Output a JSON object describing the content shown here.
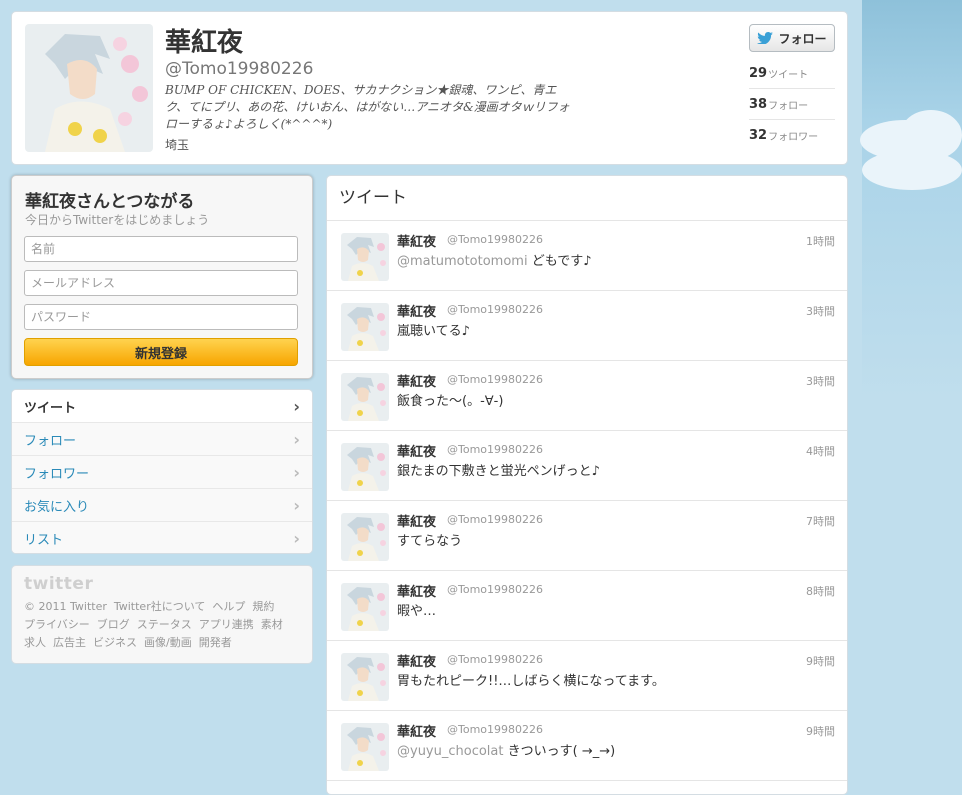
{
  "profile": {
    "name": "華紅夜",
    "handle": "@Tomo19980226",
    "bio": "BUMP OF CHICKEN、DOES、サカナクション★銀魂、ワンピ、青エク、てにプリ、あの花、けいおん、はがない…アニオタ&漫画オタｗリフォローするょ♪よろしく(*^^^*)",
    "location": "埼玉",
    "follow_button": "フォロー",
    "stats": [
      {
        "count": "29",
        "label": "ツイート"
      },
      {
        "count": "38",
        "label": "フォロー"
      },
      {
        "count": "32",
        "label": "フォロワー"
      }
    ]
  },
  "signup": {
    "title": "華紅夜さんとつながる",
    "subtitle": "今日からTwitterをはじめましょう",
    "name_placeholder": "名前",
    "email_placeholder": "メールアドレス",
    "password_placeholder": "パスワード",
    "submit": "新規登録"
  },
  "nav": {
    "items": [
      {
        "label": "ツイート"
      },
      {
        "label": "フォロー"
      },
      {
        "label": "フォロワー"
      },
      {
        "label": "お気に入り"
      },
      {
        "label": "リスト"
      }
    ]
  },
  "footer": {
    "logo": "twitter",
    "links": [
      "© 2011 Twitter",
      "Twitter社について",
      "ヘルプ",
      "規約",
      "プライバシー",
      "ブログ",
      "ステータス",
      "アプリ連携",
      "素材",
      "求人",
      "広告主",
      "ビジネス",
      "画像/動画",
      "開発者"
    ]
  },
  "timeline": {
    "header": "ツイート",
    "tweets": [
      {
        "name": "華紅夜",
        "handle": "@Tomo19980226",
        "time": "1時間",
        "mention": "@matumototomomi",
        "text": " どもです♪"
      },
      {
        "name": "華紅夜",
        "handle": "@Tomo19980226",
        "time": "3時間",
        "mention": "",
        "text": "嵐聴いてる♪"
      },
      {
        "name": "華紅夜",
        "handle": "@Tomo19980226",
        "time": "3時間",
        "mention": "",
        "text": "飯食った〜(。-∀-)"
      },
      {
        "name": "華紅夜",
        "handle": "@Tomo19980226",
        "time": "4時間",
        "mention": "",
        "text": "銀たまの下敷きと蛍光ペンげっと♪"
      },
      {
        "name": "華紅夜",
        "handle": "@Tomo19980226",
        "time": "7時間",
        "mention": "",
        "text": "すてらなう"
      },
      {
        "name": "華紅夜",
        "handle": "@Tomo19980226",
        "time": "8時間",
        "mention": "",
        "text": "暇や…"
      },
      {
        "name": "華紅夜",
        "handle": "@Tomo19980226",
        "time": "9時間",
        "mention": "",
        "text": "胃もたれピーク!!…しばらく横になってます。"
      },
      {
        "name": "華紅夜",
        "handle": "@Tomo19980226",
        "time": "9時間",
        "mention": "@yuyu_chocolat",
        "text": " きついっす( →_→)"
      }
    ]
  },
  "colors": {
    "background": "#c0deed",
    "link": "#2a8ab8",
    "signup_button": "#f7a500"
  }
}
